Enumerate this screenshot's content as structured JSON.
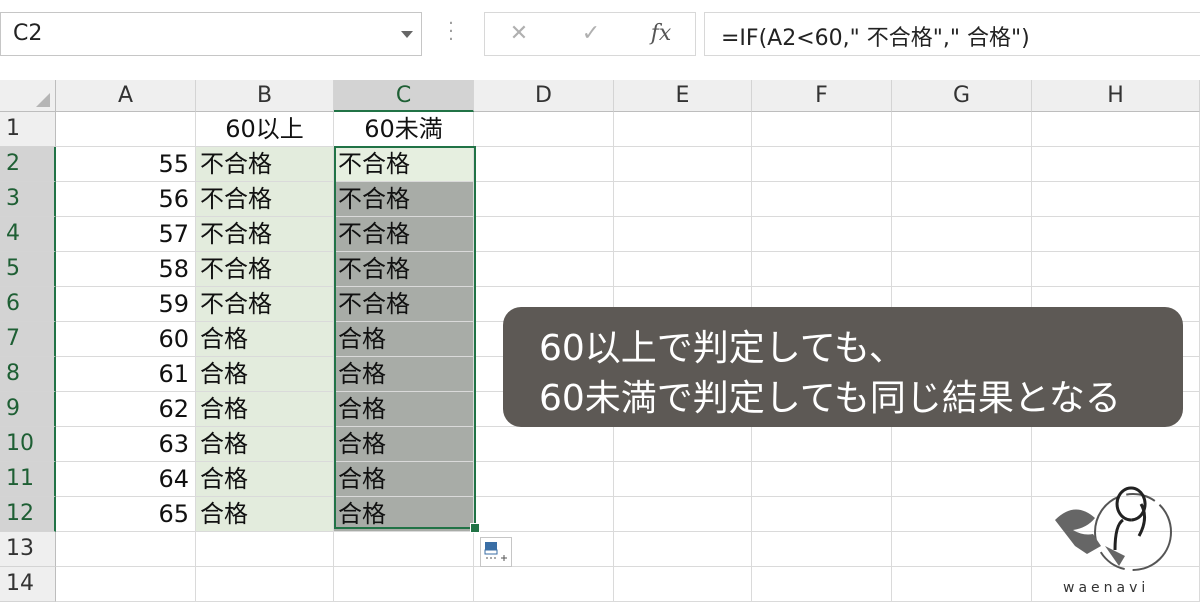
{
  "formula_bar": {
    "name_box": "C2",
    "cancel_symbol": "✕",
    "enter_symbol": "✓",
    "fx_symbol": "fx",
    "formula": "=IF(A2<60,\" 不合格\",\" 合格\")"
  },
  "columns": [
    "A",
    "B",
    "C",
    "D",
    "E",
    "F",
    "G",
    "H"
  ],
  "rows": [
    {
      "num": "1",
      "A": "",
      "B": "60以上",
      "C": "60未満"
    },
    {
      "num": "2",
      "A": "55",
      "B": "不合格",
      "C": "不合格"
    },
    {
      "num": "3",
      "A": "56",
      "B": "不合格",
      "C": "不合格"
    },
    {
      "num": "4",
      "A": "57",
      "B": "不合格",
      "C": "不合格"
    },
    {
      "num": "5",
      "A": "58",
      "B": "不合格",
      "C": "不合格"
    },
    {
      "num": "6",
      "A": "59",
      "B": "不合格",
      "C": "不合格"
    },
    {
      "num": "7",
      "A": "60",
      "B": "合格",
      "C": "合格"
    },
    {
      "num": "8",
      "A": "61",
      "B": "合格",
      "C": "合格"
    },
    {
      "num": "9",
      "A": "62",
      "B": "合格",
      "C": "合格"
    },
    {
      "num": "10",
      "A": "63",
      "B": "合格",
      "C": "合格"
    },
    {
      "num": "11",
      "A": "64",
      "B": "合格",
      "C": "合格"
    },
    {
      "num": "12",
      "A": "65",
      "B": "合格",
      "C": "合格"
    },
    {
      "num": "13",
      "A": "",
      "B": "",
      "C": ""
    },
    {
      "num": "14",
      "A": "",
      "B": "",
      "C": ""
    }
  ],
  "callout": {
    "line1": "60以上で判定しても、",
    "line2": "60未満で判定しても同じ結果となる"
  },
  "logo": {
    "text": "waenavi"
  },
  "colors": {
    "accent": "#217346",
    "callout_bg": "#5d5955",
    "selection_fill": "#a8aca7",
    "highlight_fill": "#e3ecdd"
  }
}
